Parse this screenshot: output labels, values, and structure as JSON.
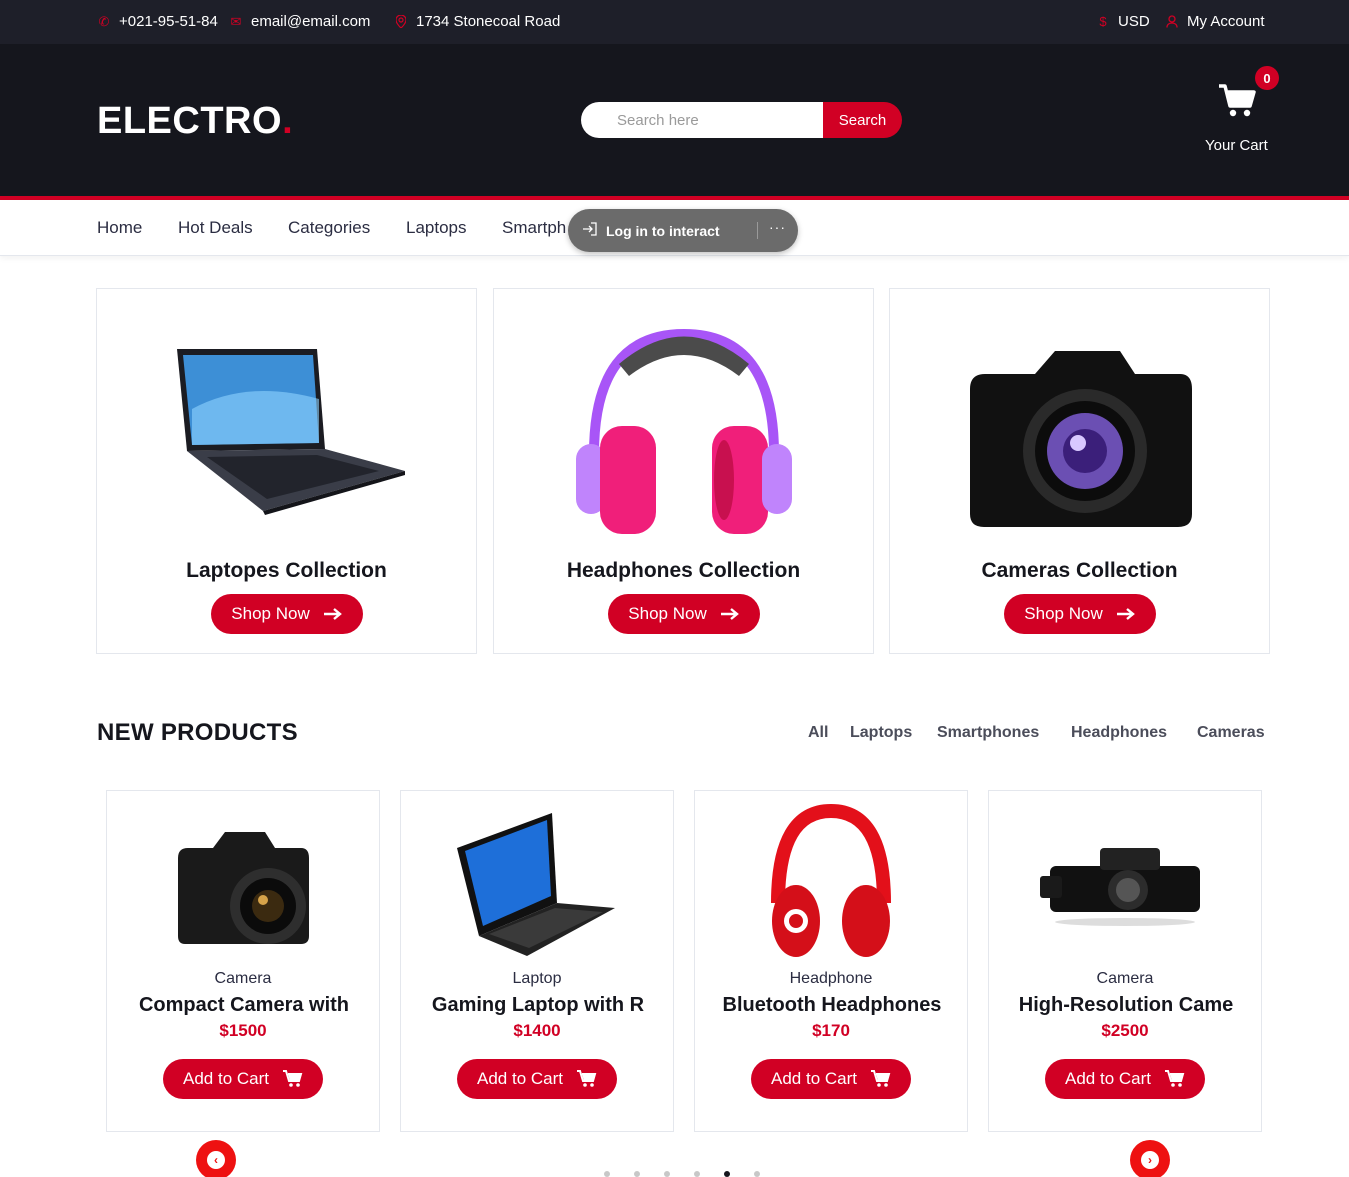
{
  "topbar": {
    "phone": "+021-95-51-84",
    "email": "email@email.com",
    "address": "1734 Stonecoal Road",
    "currency": "USD",
    "account": "My Account"
  },
  "header": {
    "logo_text": "ELECTRO",
    "logo_dot": ".",
    "search_placeholder": "Search here",
    "search_button": "Search",
    "cart_count": "0",
    "cart_label": "Your Cart"
  },
  "nav": {
    "links": [
      "Home",
      "Hot Deals",
      "Categories",
      "Laptops",
      "Smartph"
    ],
    "overlay_text": "Log in to interact",
    "overlay_more": "···"
  },
  "collections": [
    {
      "title": "Laptopes Collection",
      "button": "Shop Now",
      "icon": "laptop-image"
    },
    {
      "title": "Headphones Collection",
      "button": "Shop Now",
      "icon": "headphones-image"
    },
    {
      "title": "Cameras Collection",
      "button": "Shop Now",
      "icon": "camera-image"
    }
  ],
  "new_products": {
    "title": "NEW PRODUCTS",
    "filters": [
      "All",
      "Laptops",
      "Smartphones",
      "Headphones",
      "Cameras"
    ],
    "items": [
      {
        "category": "Camera",
        "name": "Compact Camera with",
        "price": "$1500",
        "button": "Add to Cart"
      },
      {
        "category": "Laptop",
        "name": "Gaming Laptop with R",
        "price": "$1400",
        "button": "Add to Cart"
      },
      {
        "category": "Headphone",
        "name": "Bluetooth Headphones",
        "price": "$170",
        "button": "Add to Cart"
      },
      {
        "category": "Camera",
        "name": "High-Resolution Came",
        "price": "$2500",
        "button": "Add to Cart"
      }
    ],
    "carousel_dots": 6,
    "active_dot": 4
  },
  "colors": {
    "accent": "#d10024",
    "dark": "#15161d",
    "topbar": "#1e1f29"
  }
}
